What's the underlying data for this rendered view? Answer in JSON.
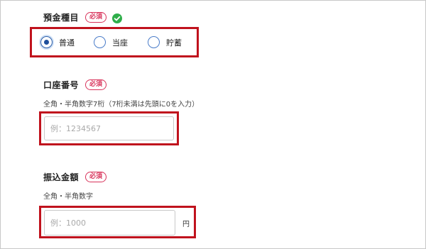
{
  "deposit_type": {
    "label": "預金種目",
    "required_badge": "必須",
    "status_icon": "check-circle-icon",
    "options": [
      {
        "label": "普通",
        "checked": true
      },
      {
        "label": "当座",
        "checked": false
      },
      {
        "label": "貯蓄",
        "checked": false
      }
    ]
  },
  "account_number": {
    "label": "口座番号",
    "required_badge": "必須",
    "hint": "全角・半角数字7桁（7桁未満は先頭に0を入力）",
    "value": "",
    "placeholder": "例：1234567"
  },
  "transfer_amount": {
    "label": "振込金額",
    "required_badge": "必須",
    "hint": "全角・半角数字",
    "value": "",
    "placeholder": "例：1000",
    "unit": "円"
  },
  "colors": {
    "required": "#d8325a",
    "highlight_border": "#c0121d",
    "check_green": "#2fae4a",
    "radio_blue": "#1f4f9b"
  }
}
